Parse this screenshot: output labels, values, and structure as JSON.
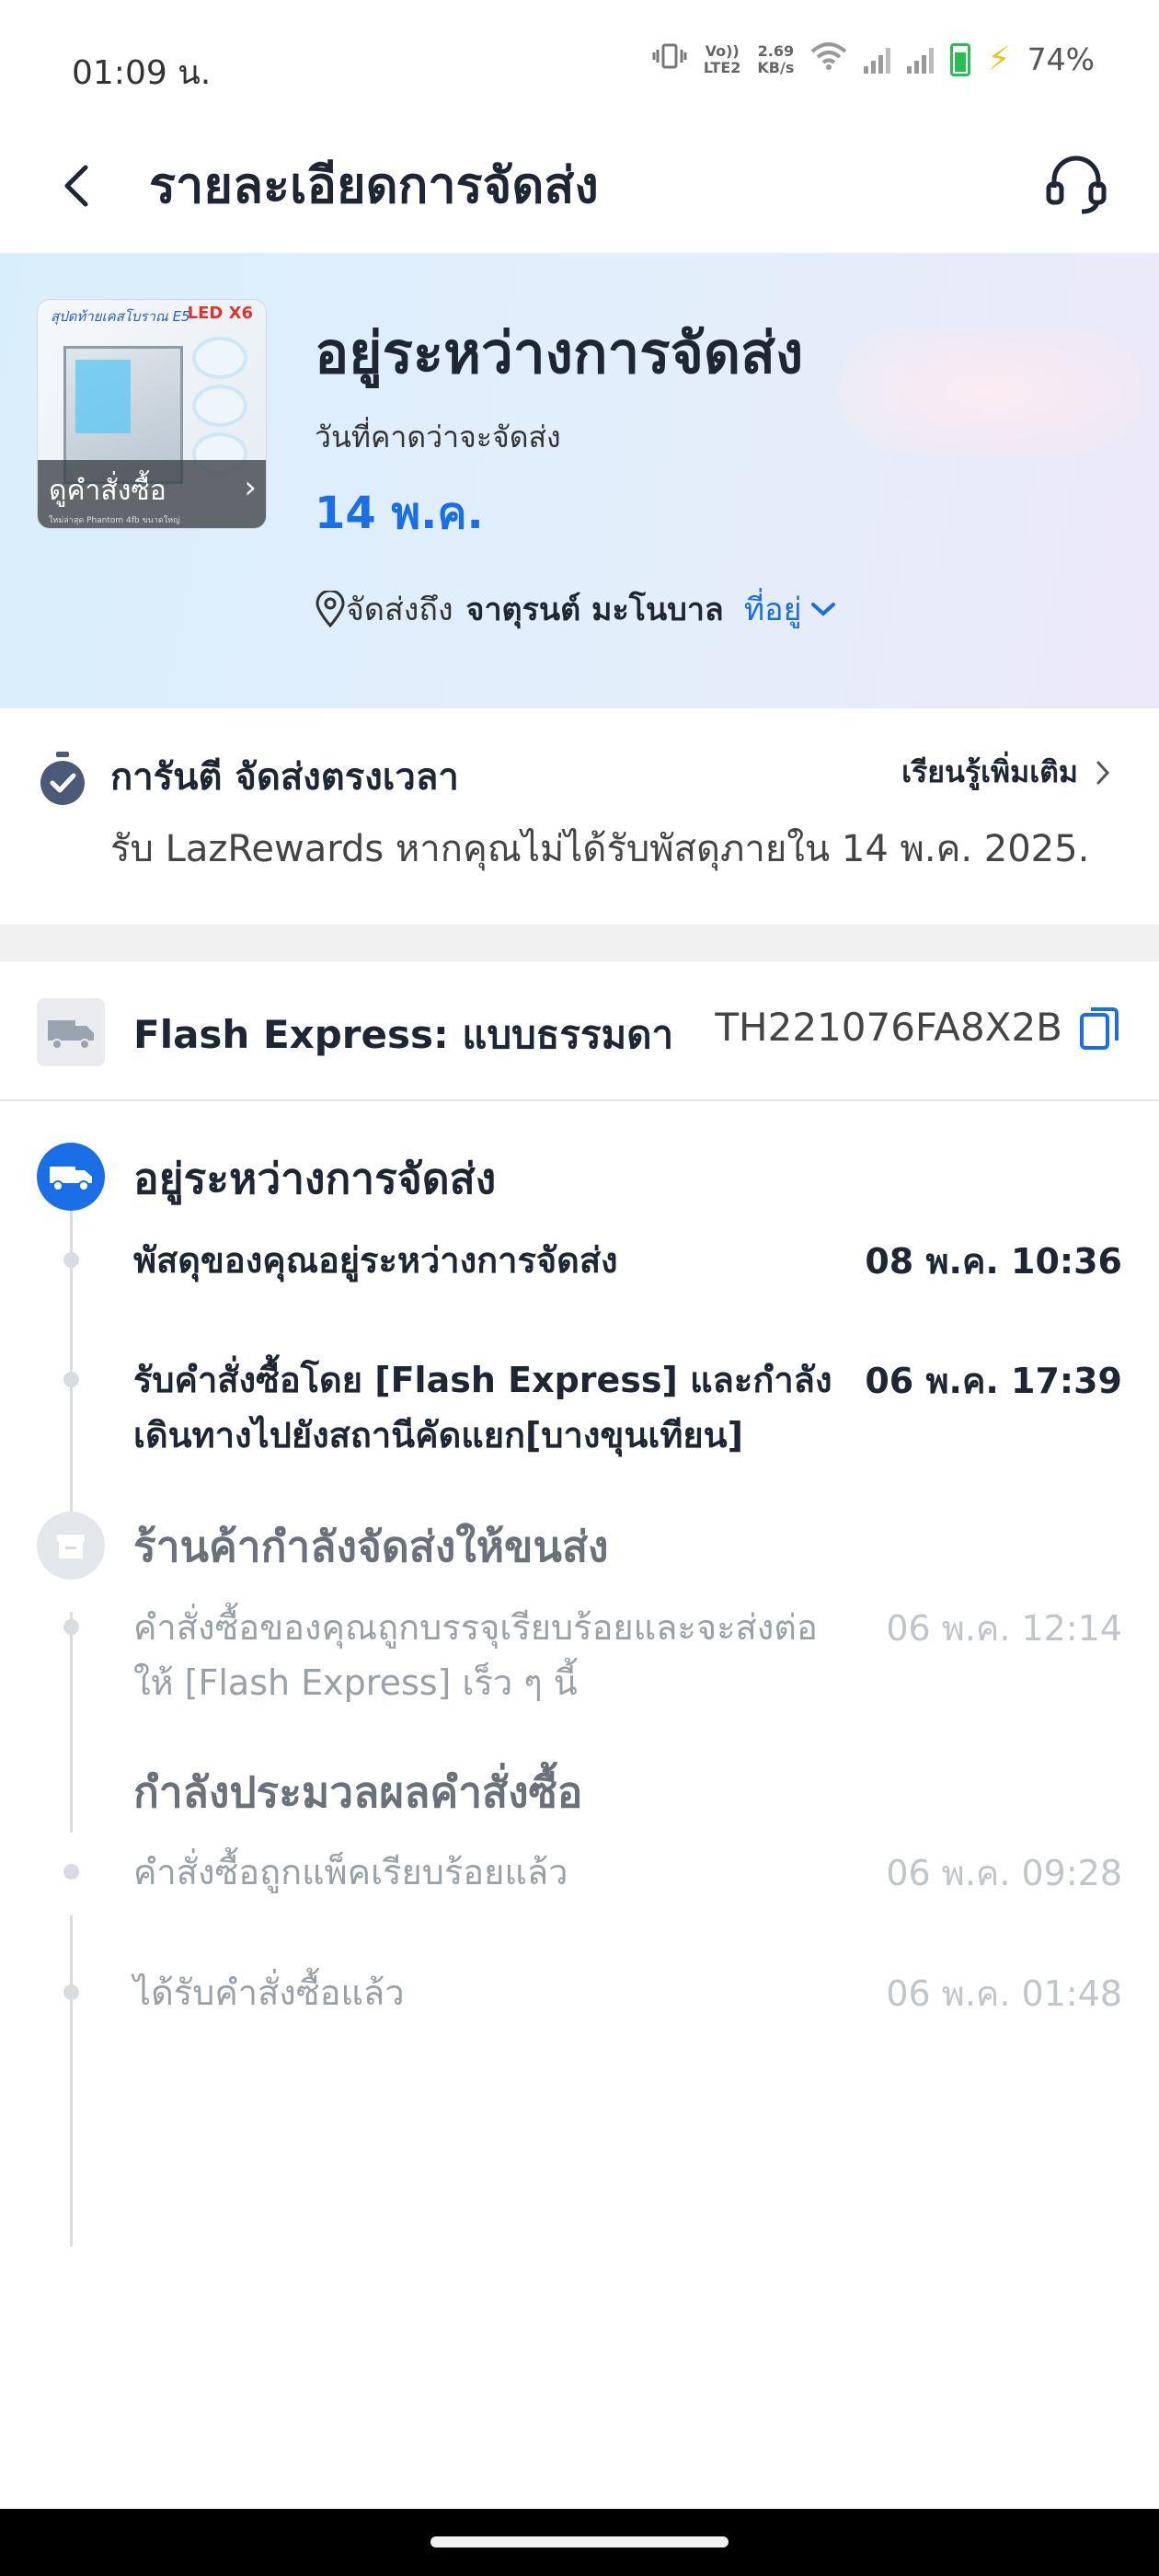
{
  "status_bar": {
    "time": "01:09 น.",
    "volte": "Vo))\nLTE2",
    "speed": "2.69\nKB/s",
    "battery_pct": "74%",
    "battery_level": 0.74,
    "colors": {
      "battery": "#2bbd55",
      "charging_bolt": "#e6c619"
    }
  },
  "header": {
    "title": "รายละเอียดการจัดส่ง",
    "back_icon": "chevron-left-icon",
    "support_icon": "headset-icon"
  },
  "hero": {
    "product_thumb": {
      "badge_text": "สุปดท้ายเคสโบราณ E5",
      "led_text": "LED X6",
      "overlay_label": "ดูคำสั่งซื้อ",
      "overlay_small": "ใหม่ล่าสุด Phantom 4fb ขนาดใหญ่"
    },
    "status": "อยู่ระหว่างการจัดส่ง",
    "eta_label": "วันที่คาดว่าจะจัดส่ง",
    "eta_date": "14 พ.ค.",
    "deliver_to_label": "จัดส่งถึง",
    "recipient": "จาตุรนต์ มะโนบาล",
    "address_link": "ที่อยู่"
  },
  "guarantee": {
    "title": "การันตี จัดส่งตรงเวลา",
    "learn_more": "เรียนรู้เพิ่มเติม",
    "subtitle": "รับ LazRewards หากคุณไม่ได้รับพัสดุภายใน 14 พ.ค. 2025."
  },
  "carrier": {
    "name": "Flash Express: แบบธรรมดา",
    "tracking_number": "TH221076FA8X2B",
    "copy_icon": "copy-icon"
  },
  "timeline": {
    "stages": [
      {
        "title": "อยู่ระหว่างการจัดส่ง",
        "icon": "truck-icon",
        "active": true,
        "events": [
          {
            "text": "พัสดุของคุณอยู่ระหว่างการจัดส่ง",
            "time": "08 พ.ค. 10:36"
          },
          {
            "text": "รับคำสั่งซื้อโดย [Flash Express] และกำลังเดินทางไปยังสถานีคัดแยก[บางขุนเทียน]",
            "time": "06 พ.ค. 17:39"
          }
        ]
      },
      {
        "title": "ร้านค้ากำลังจัดส่งให้ขนส่ง",
        "icon": "box-icon",
        "active": false,
        "events": [
          {
            "text": "คำสั่งซื้อของคุณถูกบรรจุเรียบร้อยและจะส่งต่อให้ [Flash Express] เร็ว ๆ นี้",
            "time": "06 พ.ค. 12:14"
          }
        ]
      },
      {
        "title": "กำลังประมวลผลคำสั่งซื้อ",
        "icon": "",
        "active": false,
        "events": [
          {
            "text": "คำสั่งซื้อถูกแพ็คเรียบร้อยแล้ว",
            "time": "06 พ.ค. 09:28"
          },
          {
            "text": "ได้รับคำสั่งซื้อแล้ว",
            "time": "06 พ.ค. 01:48"
          }
        ]
      }
    ]
  },
  "colors": {
    "accent": "#1a6ee6",
    "text_primary": "#1f2633",
    "text_muted": "#9aa0a8",
    "timeline_line": "#d8dce2"
  }
}
